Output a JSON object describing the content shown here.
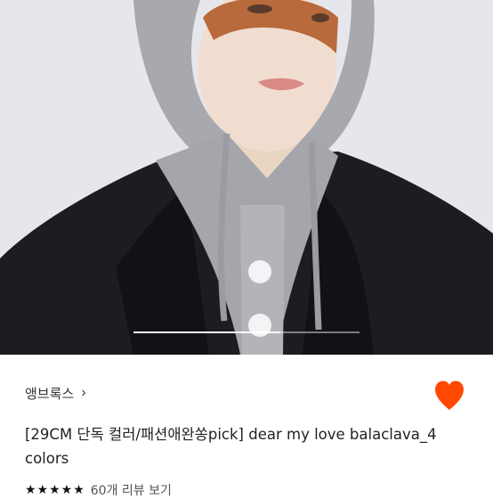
{
  "product": {
    "brand_label": "앵브록스",
    "brand_chevron": "›",
    "title": "[29CM 단독 컬러/패션애완쏭pick] dear my love balaclava_4 colors",
    "rating_stars": "★★★★★",
    "review_link": "60개 리뷰 보기"
  },
  "carousel": {
    "progress": 0.65
  },
  "colors": {
    "accent": "#ff4800",
    "text": "#222222",
    "background": "#ffffff"
  },
  "icons": {
    "like": "heart-icon",
    "brand_link": "chevron-right-icon"
  }
}
